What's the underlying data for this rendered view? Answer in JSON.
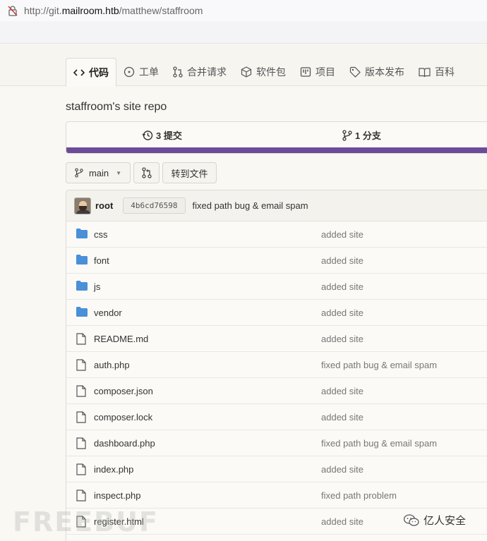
{
  "browser": {
    "url_scheme": "http://git.",
    "url_host": "mailroom.htb",
    "url_path": "/matthew/staffroom"
  },
  "tabs": [
    {
      "label": "代码",
      "icon": "code-icon",
      "active": true
    },
    {
      "label": "工单",
      "icon": "issue-icon",
      "active": false
    },
    {
      "label": "合并请求",
      "icon": "pull-request-icon",
      "active": false
    },
    {
      "label": "软件包",
      "icon": "package-icon",
      "active": false
    },
    {
      "label": "项目",
      "icon": "project-icon",
      "active": false
    },
    {
      "label": "版本发布",
      "icon": "tag-icon",
      "active": false
    },
    {
      "label": "百科",
      "icon": "book-icon",
      "active": false
    }
  ],
  "repo": {
    "description": "staffroom's site repo",
    "commits_label": "3 提交",
    "branches_label": "1 分支",
    "language_color": "#6c4c9a"
  },
  "toolbar": {
    "branch": "main",
    "goto_file": "转到文件"
  },
  "latest_commit": {
    "user": "root",
    "sha": "4b6cd76598",
    "message": "fixed path bug & email spam"
  },
  "files": [
    {
      "type": "dir",
      "name": "css",
      "message": "added site"
    },
    {
      "type": "dir",
      "name": "font",
      "message": "added site"
    },
    {
      "type": "dir",
      "name": "js",
      "message": "added site"
    },
    {
      "type": "dir",
      "name": "vendor",
      "message": "added site"
    },
    {
      "type": "file",
      "name": "README.md",
      "message": "added site"
    },
    {
      "type": "file",
      "name": "auth.php",
      "message": "fixed path bug & email spam"
    },
    {
      "type": "file",
      "name": "composer.json",
      "message": "added site"
    },
    {
      "type": "file",
      "name": "composer.lock",
      "message": "added site"
    },
    {
      "type": "file",
      "name": "dashboard.php",
      "message": "fixed path bug & email spam"
    },
    {
      "type": "file",
      "name": "index.php",
      "message": "added site"
    },
    {
      "type": "file",
      "name": "inspect.php",
      "message": "fixed path problem"
    },
    {
      "type": "file",
      "name": "register.html",
      "message": "added site"
    }
  ],
  "watermark": {
    "left": "FREEBUF",
    "right": "亿人安全"
  }
}
